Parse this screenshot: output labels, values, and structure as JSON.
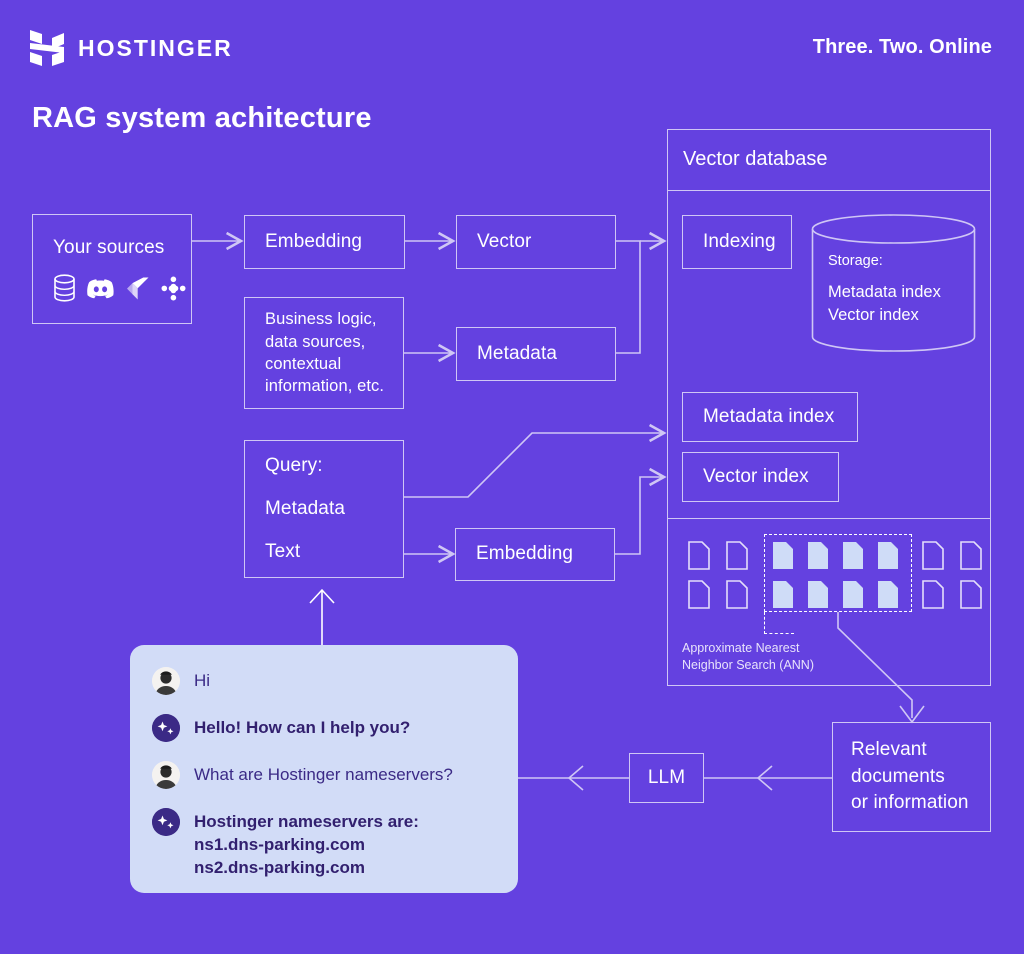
{
  "brand": {
    "wordmark": "HOSTINGER",
    "logo_icon": "hostinger-h-logo-icon",
    "tagline": "Three. Two. Online"
  },
  "page": {
    "title": "RAG system achitecture",
    "background_color": "#6441e0",
    "stroke_color": "#cfc6f5"
  },
  "nodes": {
    "your_sources": {
      "label": "Your sources",
      "icons": [
        "database-icon",
        "discord-icon",
        "jira-icon",
        "slack-icon"
      ]
    },
    "embedding_top": {
      "label": "Embedding"
    },
    "vector": {
      "label": "Vector"
    },
    "business_logic": {
      "label": "Business logic,\ndata sources,\ncontextual\ninformation, etc."
    },
    "metadata": {
      "label": "Metadata"
    },
    "query": {
      "line1": "Query:",
      "line2": "Metadata",
      "line3": "Text"
    },
    "embedding_bottom": {
      "label": "Embedding"
    },
    "vector_database": {
      "label": "Vector database"
    },
    "indexing": {
      "label": "Indexing"
    },
    "storage": {
      "caption": "Storage:",
      "items": [
        "Metadata index",
        "Vector index"
      ]
    },
    "metadata_index": {
      "label": "Metadata index"
    },
    "vector_index": {
      "label": "Vector index"
    },
    "ann": {
      "caption": "Approximate Nearest\nNeighbor Search (ANN)"
    },
    "llm": {
      "label": "LLM"
    },
    "relevant_documents": {
      "label": "Relevant\ndocuments\nor information"
    }
  },
  "chat": {
    "background_color": "#d2dcf7",
    "text_color": "#3b2a86",
    "messages": [
      {
        "sender": "user",
        "avatar": "user-avatar-icon",
        "text": "Hi",
        "bold": false
      },
      {
        "sender": "bot",
        "avatar": "ai-sparkle-avatar-icon",
        "text": "Hello! How can I help you?",
        "bold": true
      },
      {
        "sender": "user",
        "avatar": "user-avatar-icon",
        "text": "What are Hostinger nameservers?",
        "bold": false
      },
      {
        "sender": "bot",
        "avatar": "ai-sparkle-avatar-icon",
        "text": "Hostinger nameservers are:\nns1.dns-parking.com\nns2.dns-parking.com",
        "bold": true
      }
    ]
  }
}
